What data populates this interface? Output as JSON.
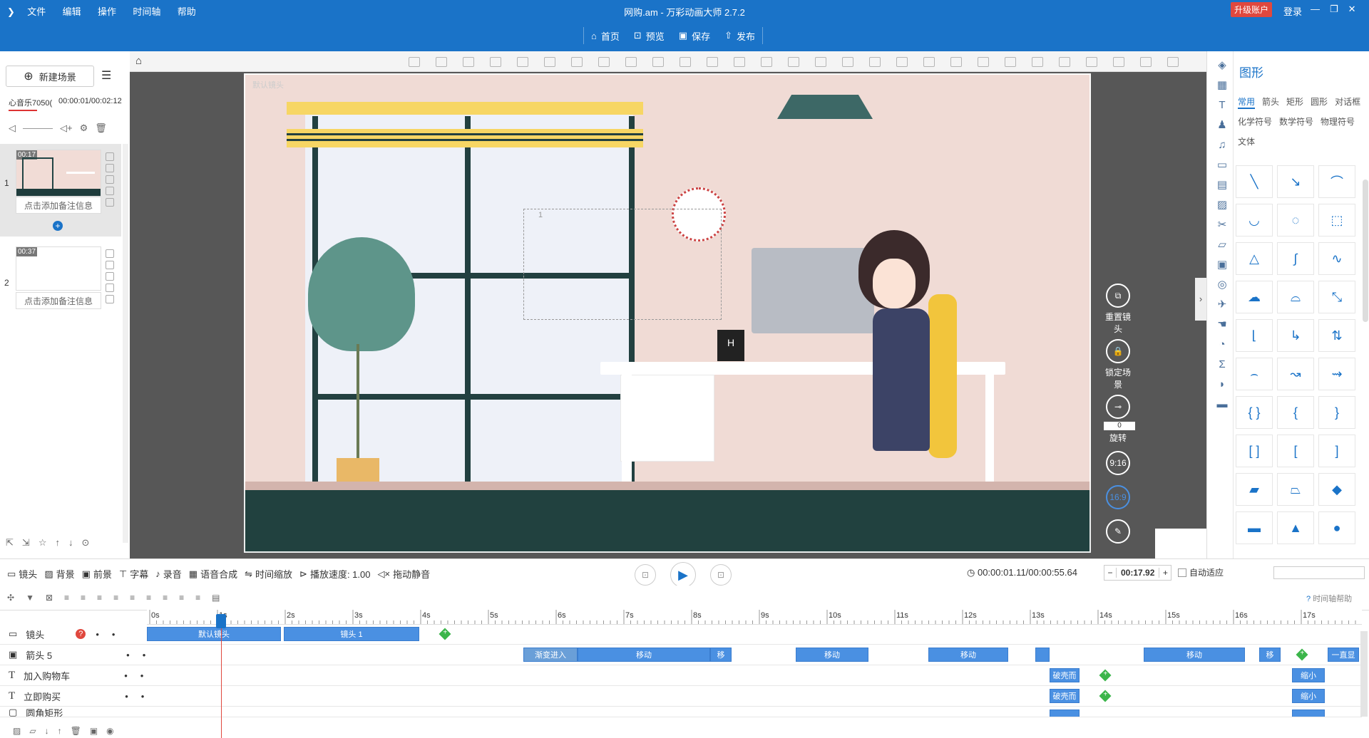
{
  "app": {
    "title": "网购.am - 万彩动画大师 2.7.2",
    "menu": [
      "文件",
      "编辑",
      "操作",
      "时间轴",
      "帮助"
    ],
    "upgrade": "升级账户",
    "login": "登录"
  },
  "toolbar": {
    "home": "首页",
    "preview": "预览",
    "save": "保存",
    "publish": "发布"
  },
  "left": {
    "new_scene": "新建场景",
    "music_name": "心音乐7050(",
    "music_time": "00:00:01/00:02:12",
    "scenes": [
      {
        "index": "1",
        "time": "00:17",
        "note": "点击添加备注信息"
      },
      {
        "index": "2",
        "time": "00:37",
        "note": "点击添加备注信息"
      }
    ]
  },
  "stage": {
    "camera_label": "默认镜头",
    "frame_label": "1",
    "mug_letter": "H"
  },
  "floatbtns": {
    "reset": "重置镜头",
    "lock": "锁定场景",
    "rotate": "旋转",
    "rotate_value": "0",
    "ratio_916": "9:16",
    "ratio_169": "16:9"
  },
  "right": {
    "title": "图形",
    "tabs_row1": [
      "常用",
      "箭头",
      "矩形",
      "圆形",
      "对话框"
    ],
    "tabs_row2": [
      "化学符号",
      "数学符号",
      "物理符号"
    ],
    "tabs_row3": [
      "文体"
    ]
  },
  "timeline": {
    "buttons": [
      "镜头",
      "背景",
      "前景",
      "字幕",
      "录音",
      "语音合成",
      "时间缩放",
      "播放速度: 1.00",
      "拖动静音"
    ],
    "time_display": "00:00:01.11/00:00:55.64",
    "duration": "00:17.92",
    "auto_fit": "自动适应",
    "help": "时间轴帮助",
    "ruler": [
      "0s",
      "1s",
      "2s",
      "3s",
      "4s",
      "5s",
      "6s",
      "7s",
      "8s",
      "9s",
      "10s",
      "11s",
      "12s",
      "13s",
      "14s",
      "15s",
      "16s",
      "17s"
    ],
    "tracks": [
      {
        "name": "镜头"
      },
      {
        "name": "箭头 5"
      },
      {
        "name": "加入购物车"
      },
      {
        "name": "立即购买"
      },
      {
        "name": "圆角矩形"
      }
    ],
    "clips": {
      "cam1": "默认镜头",
      "cam2": "镜头 1",
      "fade": "渐变进入",
      "move": "移动",
      "move_short": "移",
      "end": "一直显",
      "blink": "破壳而",
      "shrink": "缩小"
    }
  },
  "colors": {
    "primary": "#1a73c8",
    "clip": "#4a90e2",
    "upgrade": "#e0483e",
    "green": "#3bb54a"
  }
}
